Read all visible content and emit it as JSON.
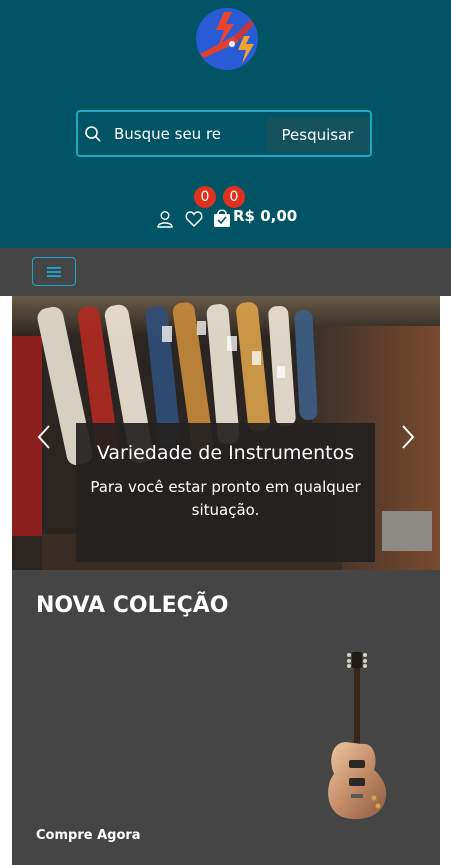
{
  "header": {
    "logo_icon": "guitar-lightning-logo",
    "search": {
      "placeholder": "Busque seu re",
      "button_label": "Pesquisar"
    },
    "account_icon": "user-icon",
    "wishlist": {
      "icon": "heart-icon",
      "count": "0"
    },
    "cart": {
      "icon": "shopping-bag-icon",
      "count": "0",
      "total": "R$ 0,00"
    }
  },
  "nav": {
    "menu_icon": "hamburger-icon"
  },
  "slider": {
    "title": "Variedade de Instrumentos",
    "text": "Para você estar pronto em qualquer situação.",
    "prev_icon": "chevron-left-icon",
    "next_icon": "chevron-right-icon"
  },
  "promo": {
    "title": "NOVA COLEÇÃO",
    "link": "Compre Agora"
  },
  "colors": {
    "header_bg": "#005466",
    "nav_bg": "#454545",
    "badge": "#e0311e",
    "accent": "#1fa7c4"
  }
}
